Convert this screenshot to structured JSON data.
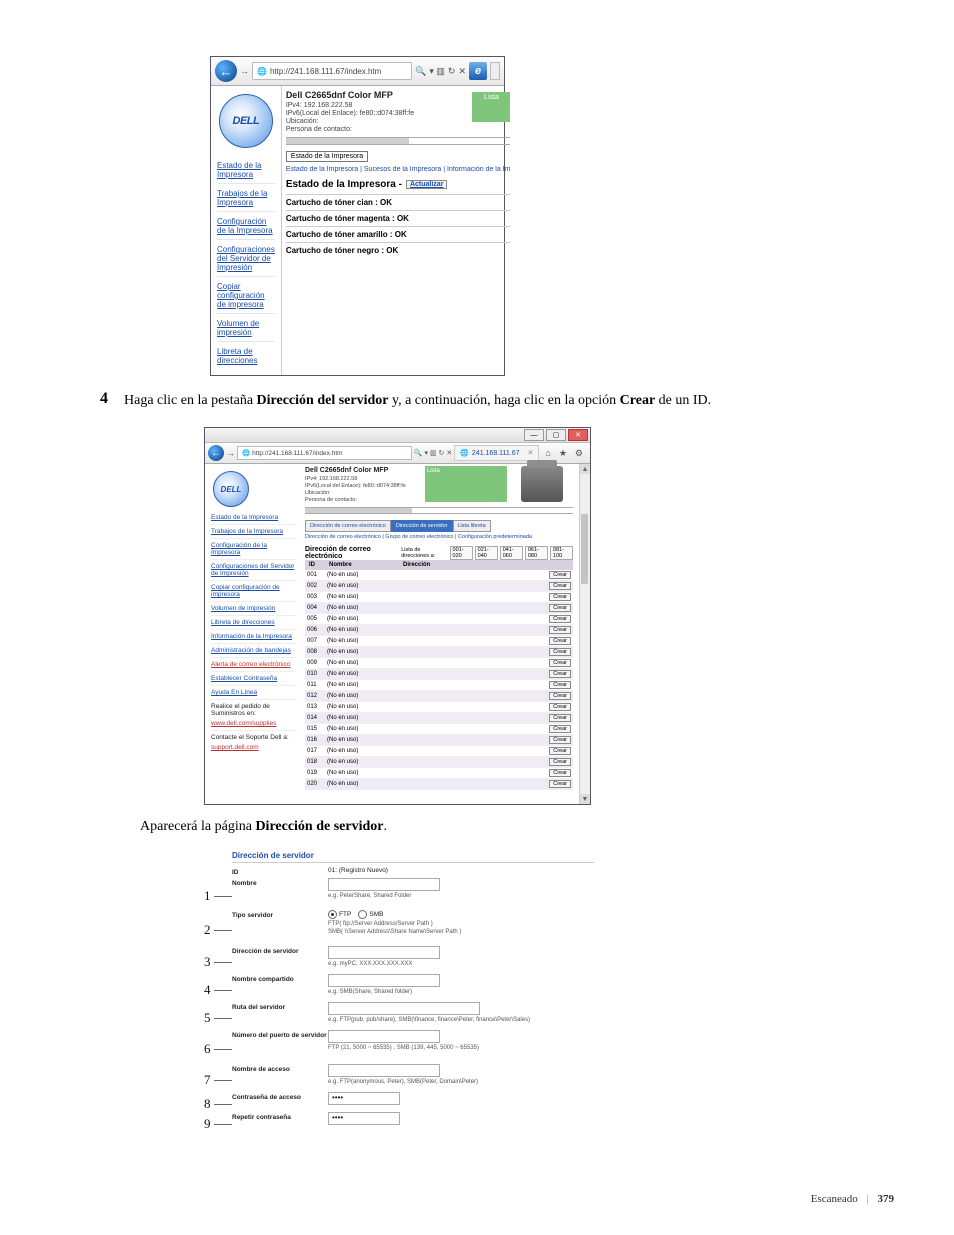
{
  "step4": {
    "num": "4",
    "text_a": "Haga clic en la pestaña ",
    "text_b": "Dirección del servidor",
    "text_c": " y, a continuación, haga clic en la opción ",
    "text_d": "Crear",
    "text_e": " de un ID."
  },
  "followup": {
    "a": "Aparecerá la página ",
    "b": "Dirección de servidor",
    "c": "."
  },
  "ie": {
    "url": "http://241.168.111.67/index.htm",
    "search_glyph": "🔍",
    "refresh_glyph": "↻",
    "stop_glyph": "✕",
    "e_glyph": "e",
    "back_glyph": "←",
    "fwd_glyph": "→"
  },
  "printer": {
    "logo": "DELL",
    "model": "Dell C2665dnf Color MFP",
    "ipv4": "IPv4: 192.168.222.58",
    "ipv6": "IPv6(Local del Enlace): fe80::d074:38ff:fe",
    "loc_label": "Ubicación:",
    "contact_label": "Persona de contacto:"
  },
  "side": {
    "estado": "Estado de la Impresora",
    "trabajos": "Trabajos de la Impresora",
    "config_imp": "Configuración de la Impresora",
    "config_srv": "Configuraciones del Servidor de Impresión",
    "copiar": "Copiar configuración de impresora",
    "volumen": "Volumen de impresión",
    "libreta": "Libreta de direcciones",
    "info": "Información de la Impresora",
    "bandejas": "Administración de bandejas",
    "alerta": "Alerta de correo electrónico",
    "pwd": "Establecer Contraseña",
    "ayuda": "Ayuda En Línea",
    "pedido1": "Realice el pedido de Suministros en:",
    "pedido2": "www.dell.com/supplies",
    "soporte1": "Contacte el Soporte Dell a:",
    "soporte2": "support.dell.com"
  },
  "shot1_main": {
    "listo": "Lista",
    "box": "Estado de la Impresora",
    "crumbs": "Estado de la Impresora | Sucesos de la Impresora | Información de la Im",
    "section": "Estado de la Impresora - ",
    "refresh": "Actualizar",
    "cyan": "Cartucho de tóner cian : OK",
    "magenta": "Cartucho de tóner magenta : OK",
    "yellow": "Cartucho de tóner amarillo : OK",
    "black": "Cartucho de tóner negro : OK"
  },
  "shot2_main": {
    "tab1": "Dirección de correo electrónico",
    "tab2": "Dirección de servidor",
    "tab3": "Lista libreta",
    "blue_links": "Dirección de correo electrónico | Grupo de correo electrónico | Configuración predeterminada",
    "table_title": "Dirección de correo electrónico",
    "pager_label": "Lista de direcciones a:",
    "pager": [
      "001-020",
      "021-040",
      "041-060",
      "061-080",
      "081-100"
    ],
    "head_id": "ID",
    "head_nombre": "Nombre",
    "head_dir": "Dirección",
    "not_used": "(No en uso)",
    "crear": "Crear",
    "rows": [
      {
        "id": "001"
      },
      {
        "id": "002"
      },
      {
        "id": "003"
      },
      {
        "id": "004"
      },
      {
        "id": "005"
      },
      {
        "id": "006"
      },
      {
        "id": "007"
      },
      {
        "id": "008"
      },
      {
        "id": "009"
      },
      {
        "id": "010"
      },
      {
        "id": "011"
      },
      {
        "id": "012"
      },
      {
        "id": "013"
      },
      {
        "id": "014"
      },
      {
        "id": "015"
      },
      {
        "id": "016"
      },
      {
        "id": "017"
      },
      {
        "id": "018"
      },
      {
        "id": "019"
      },
      {
        "id": "020"
      }
    ]
  },
  "shot2_tab": {
    "label": "241.168.111.67",
    "home": "⌂",
    "star": "★",
    "gear": "⚙"
  },
  "form": {
    "title": "Dirección de servidor",
    "id_label": "ID",
    "id_val": "01: (Registro Nuevo)",
    "nombre_label": "Nombre",
    "nombre_hint": "e.g. PeterShare, Shared Folder",
    "tipo_label": "Tipo servidor",
    "ftp": "FTP",
    "smb": "SMB",
    "tipo_hint1": "FTP( ftp://Server Address/Server Path )",
    "tipo_hint2": "SMB( \\\\Server Address\\Share Name\\Server Path )",
    "dir_label": "Dirección de servidor",
    "dir_hint": "e.g. myPC, XXX.XXX.XXX.XXX",
    "share_label": "Nombre compartido",
    "share_hint": "e.g. SMB(Share, Shared folder)",
    "ruta_label": "Ruta del servidor",
    "ruta_hint": "e.g. FTP(pub, pub/share),  SMB(\\finance, finance\\Peter, finance\\Peter\\Sales)",
    "puerto_label": "Número del puerto de servidor",
    "puerto_hint": "FTP (21, 5000 ~ 65535) ,  SMB (139, 445, 5000 ~ 65535)",
    "login_label": "Nombre de acceso",
    "login_hint": "e.g. FTP(anonymous, Peter), SMB(Peter, Domain\\Peter)",
    "pwd_label": "Contraseña de acceso",
    "pwd2_label": "Repetir contraseña",
    "dots": "••••"
  },
  "callouts": [
    "1",
    "2",
    "3",
    "4",
    "5",
    "6",
    "7",
    "8",
    "9"
  ],
  "footer": {
    "section": "Escaneado",
    "page": "379"
  }
}
